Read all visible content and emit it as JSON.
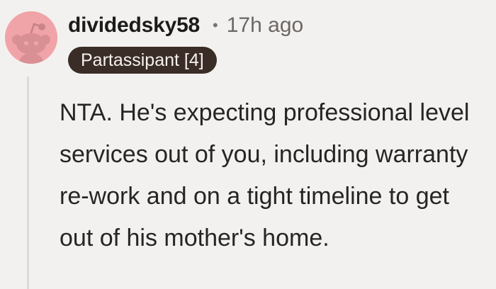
{
  "comment": {
    "username": "dividedsky58",
    "separator": "•",
    "timestamp": "17h ago",
    "flair": "Partassipant [4]",
    "body": "NTA. He's expecting professional level services out of you, including warranty re-work and on a tight timeline to get out of his mother's home.",
    "avatar_icon": "snoo-avatar-icon"
  },
  "colors": {
    "avatar_bg": "#f1a4a8",
    "flair_bg": "#3a2c27",
    "flair_text": "#f6f2ee",
    "page_bg": "#f3f1ef"
  }
}
